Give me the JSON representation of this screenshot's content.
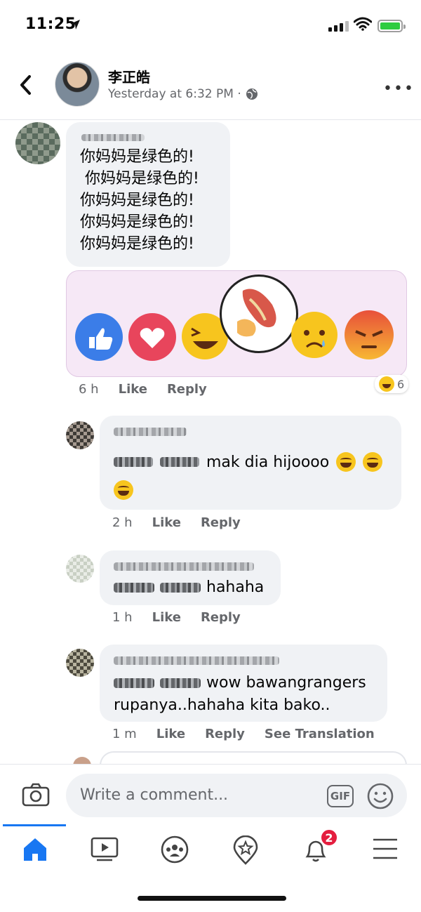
{
  "status_bar": {
    "time": "11:25"
  },
  "header": {
    "name": "李正皓",
    "timestamp": "Yesterday at 6:32 PM ·"
  },
  "comments": [
    {
      "lines": [
        "你妈妈是绿色的!",
        " 你妈妈是绿色的!",
        "你妈妈是绿色的!",
        "你妈妈是绿色的!",
        "你妈妈是绿色的!"
      ],
      "time": "6 h",
      "like": "Like",
      "reply": "Reply",
      "reaction_count": "6"
    }
  ],
  "replies": [
    {
      "text": "mak dia hijoooo",
      "time": "2 h",
      "like": "Like",
      "reply": "Reply"
    },
    {
      "text": "hahaha",
      "time": "1 h",
      "like": "Like",
      "reply": "Reply"
    },
    {
      "text_line1": "wow bawangrangers",
      "text_line2": "rupanya..hahaha kita bako..",
      "time": "1 m",
      "like": "Like",
      "reply": "Reply",
      "see_translation": "See Translation"
    }
  ],
  "compose": {
    "placeholder": "Write a comment...",
    "gif_label": "GIF"
  },
  "tabbar": {
    "notification_badge": "2"
  },
  "colors": {
    "accent": "#1877f2",
    "badge": "#e41e3f",
    "bubble": "#f0f2f5",
    "meta": "#65676b"
  }
}
